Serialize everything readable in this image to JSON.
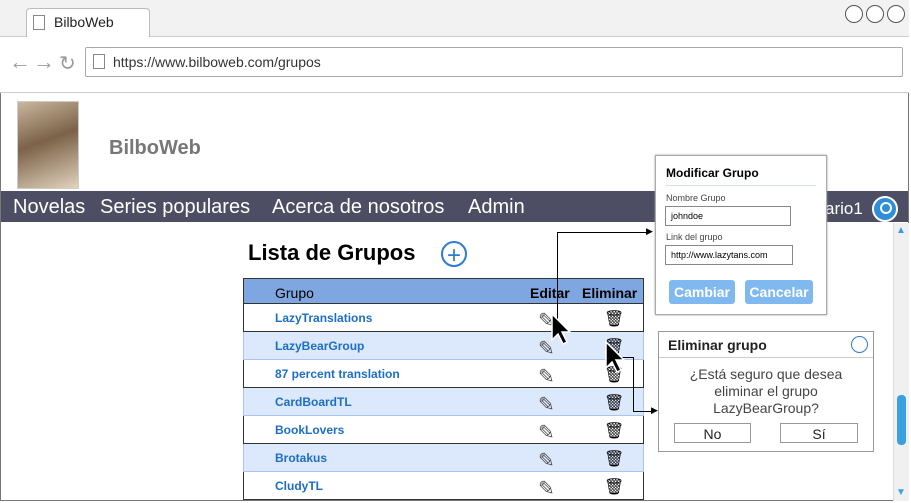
{
  "browser": {
    "tab_title": "BilboWeb",
    "url": "https://www.bilboweb.com/grupos"
  },
  "site": {
    "brand": "BilboWeb",
    "menu": [
      "Novelas",
      "Series populares",
      "Acerca de nosotros",
      "Admin"
    ],
    "user": "ario1"
  },
  "groups": {
    "title": "Lista de Grupos",
    "columns": {
      "name": "Grupo",
      "edit": "Editar",
      "delete": "Eliminar"
    },
    "rows": [
      "LazyTranslations",
      "LazyBearGroup",
      "87 percent translation",
      "CardBoardTL",
      "BookLovers",
      "Brotakus",
      "CludyTL"
    ]
  },
  "edit_modal": {
    "title": "Modificar Grupo",
    "name_label": "Nombre Grupo",
    "name_value": "johndoe",
    "link_label": "Link del grupo",
    "link_value": "http://www.lazytans.com",
    "save": "Cambiar",
    "cancel": "Cancelar"
  },
  "delete_modal": {
    "title": "Eliminar grupo",
    "message": "¿Está seguro que desea eliminar el grupo LazyBearGroup?",
    "no": "No",
    "yes": "Sí"
  },
  "colors": {
    "menubar": "#4d4d63",
    "table_header": "#7ea6e0",
    "link": "#1c6ec7",
    "button": "#7fb9ef"
  }
}
